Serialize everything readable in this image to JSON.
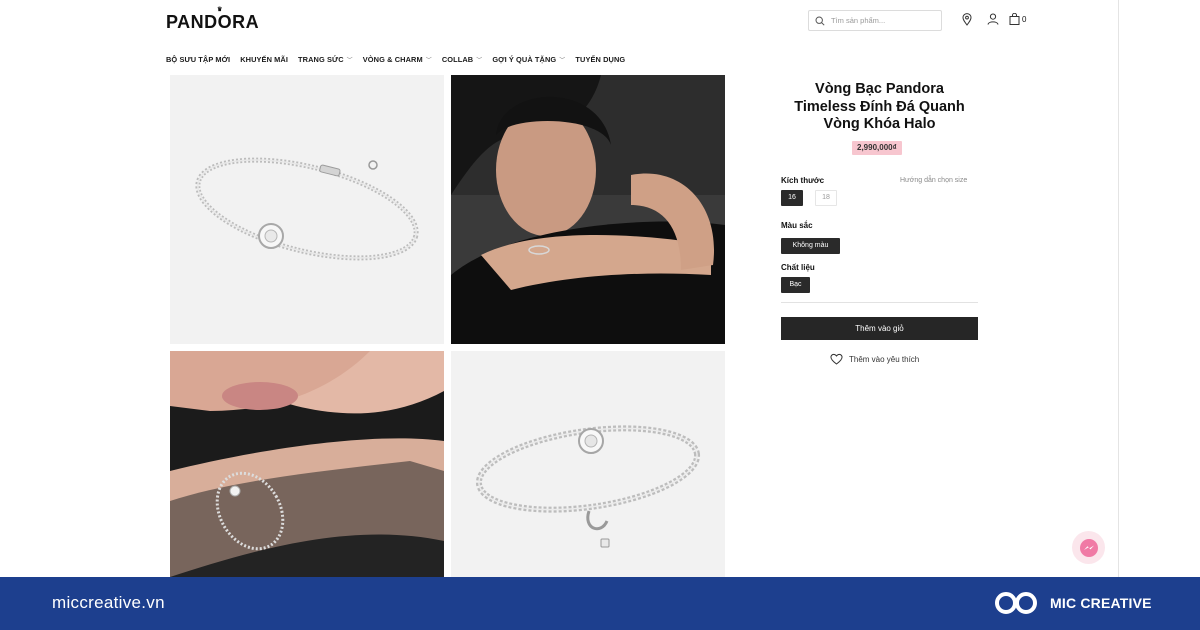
{
  "header": {
    "logo_text": "PANDORA",
    "search_placeholder": "Tìm sản phẩm...",
    "cart_count": "0"
  },
  "nav": [
    {
      "label": "BỘ SƯU TẬP MỚI",
      "has_dropdown": false
    },
    {
      "label": "KHUYẾN MÃI",
      "has_dropdown": false
    },
    {
      "label": "TRANG SỨC",
      "has_dropdown": true
    },
    {
      "label": "VÒNG & CHARM",
      "has_dropdown": true
    },
    {
      "label": "COLLAB",
      "has_dropdown": true
    },
    {
      "label": "GỢI Ý QUÀ TẶNG",
      "has_dropdown": true
    },
    {
      "label": "TUYỂN DỤNG",
      "has_dropdown": false
    }
  ],
  "product": {
    "title_lines": [
      "Vòng Bạc Pandora",
      "Timeless Đính Đá Quanh",
      "Vòng Khóa Halo"
    ],
    "price": "2,990,000₫",
    "size_label": "Kích thước",
    "size_guide": "Hướng dẫn chọn size",
    "sizes": [
      {
        "label": "16",
        "selected": true
      },
      {
        "label": "18",
        "selected": false
      }
    ],
    "color_label": "Màu sắc",
    "color_value": "Không màu",
    "material_label": "Chất liệu",
    "material_value": "Bạc",
    "add_to_cart": "Thêm vào giỏ",
    "wishlist": "Thêm vào yêu thích"
  },
  "footer": {
    "url": "miccreative.vn",
    "brand": "MIC CREATIVE"
  },
  "colors": {
    "price_bg": "#f7c6cf",
    "button_dark": "#262626",
    "footer_bg": "#1d3f8e",
    "messenger_bg": "#fbe6ec"
  },
  "icons": [
    "search-icon",
    "location-pin-icon",
    "user-icon",
    "shopping-bag-icon",
    "chevron-down-icon",
    "heart-icon",
    "messenger-icon",
    "mic-creative-logo-icon"
  ]
}
